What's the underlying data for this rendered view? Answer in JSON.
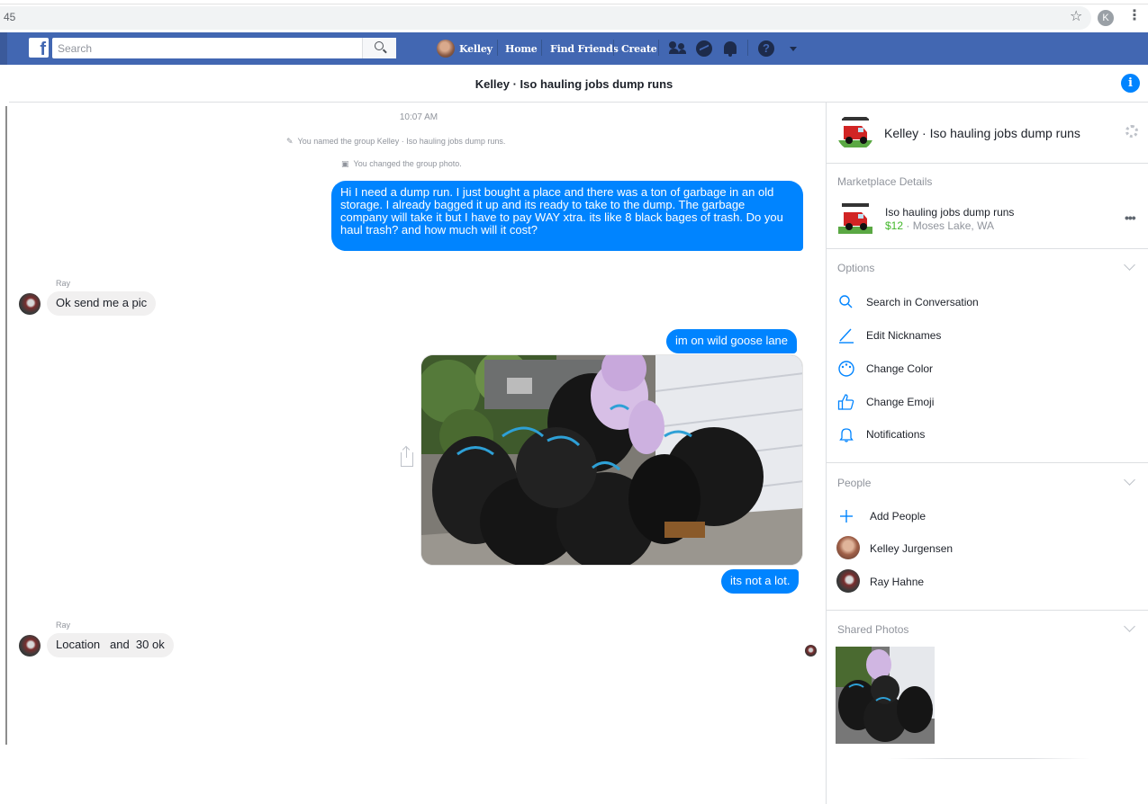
{
  "browser": {
    "url_fragment": "45",
    "profile_initial": "K"
  },
  "header": {
    "search_placeholder": "Search",
    "user_name": "Kelley",
    "nav": {
      "home": "Home",
      "find_friends": "Find Friends",
      "create": "Create"
    }
  },
  "conversation": {
    "title": "Kelley · Iso hauling jobs dump runs",
    "timestamp": "10:07 AM",
    "system_notes": [
      "You named the group Kelley · Iso hauling jobs dump runs.",
      "You changed the group photo."
    ],
    "messages": {
      "m1": "Hi I need a dump run. I just bought a place and there was a ton of garbage in an old storage. I already bagged it up and its ready to take to the dump. The garbage company will take it but I have to pay WAY xtra. its like 8 black bages of trash. Do you haul trash? and how much will it cost?",
      "m2_sender": "Ray",
      "m2": "Ok send me a pic",
      "m3": "im on wild goose lane",
      "m4": "its not a lot.",
      "m5_sender": "Ray",
      "m5": "Location   and  30 ok"
    }
  },
  "sidebar": {
    "group_title": "Kelley · Iso hauling jobs dump runs",
    "marketplace_heading": "Marketplace Details",
    "listing_title": "Iso hauling jobs dump runs",
    "listing_price": "$12",
    "listing_location": " · Moses Lake, WA",
    "options_heading": "Options",
    "options": [
      "Search in Conversation",
      "Edit Nicknames",
      "Change Color",
      "Change Emoji",
      "Notifications"
    ],
    "people_heading": "People",
    "add_people": "Add People",
    "people": [
      "Kelley Jurgensen",
      "Ray Hahne"
    ],
    "shared_photos_heading": "Shared Photos"
  },
  "colors": {
    "fb_blue": "#4267b2",
    "messenger_blue": "#0084ff",
    "price_green": "#42b72a"
  }
}
